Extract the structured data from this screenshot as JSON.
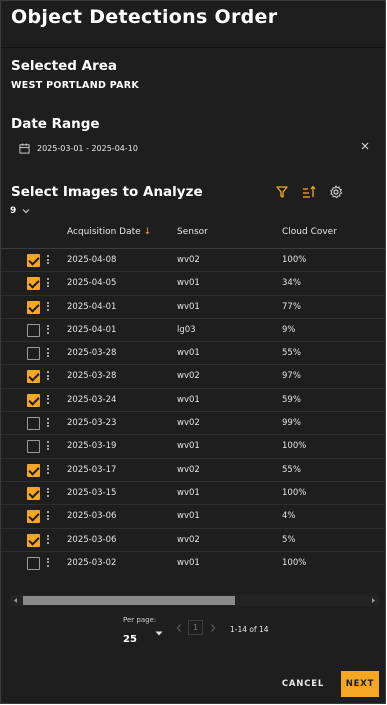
{
  "title": "Object Detections Order",
  "selected_area": {
    "heading": "Selected Area",
    "name": "WEST PORTLAND PARK"
  },
  "date_range": {
    "heading": "Date Range",
    "value": "2025-03-01 - 2025-04-10"
  },
  "images": {
    "heading": "Select Images to Analyze",
    "selected_count": "9",
    "columns": {
      "date": "Acquisition Date",
      "sensor": "Sensor",
      "cloud": "Cloud Cover"
    },
    "sort_indicator": "↓",
    "rows": [
      {
        "checked": true,
        "date": "2025-04-08",
        "sensor": "wv02",
        "cloud": "100%"
      },
      {
        "checked": true,
        "date": "2025-04-05",
        "sensor": "wv01",
        "cloud": "34%"
      },
      {
        "checked": true,
        "date": "2025-04-01",
        "sensor": "wv01",
        "cloud": "77%"
      },
      {
        "checked": false,
        "date": "2025-04-01",
        "sensor": "lg03",
        "cloud": "9%"
      },
      {
        "checked": false,
        "date": "2025-03-28",
        "sensor": "wv01",
        "cloud": "55%"
      },
      {
        "checked": true,
        "date": "2025-03-28",
        "sensor": "wv02",
        "cloud": "97%"
      },
      {
        "checked": true,
        "date": "2025-03-24",
        "sensor": "wv01",
        "cloud": "59%"
      },
      {
        "checked": false,
        "date": "2025-03-23",
        "sensor": "wv02",
        "cloud": "99%"
      },
      {
        "checked": false,
        "date": "2025-03-19",
        "sensor": "wv01",
        "cloud": "100%"
      },
      {
        "checked": true,
        "date": "2025-03-17",
        "sensor": "wv02",
        "cloud": "55%"
      },
      {
        "checked": true,
        "date": "2025-03-15",
        "sensor": "wv01",
        "cloud": "100%"
      },
      {
        "checked": true,
        "date": "2025-03-06",
        "sensor": "wv01",
        "cloud": "4%"
      },
      {
        "checked": true,
        "date": "2025-03-06",
        "sensor": "wv02",
        "cloud": "5%"
      },
      {
        "checked": false,
        "date": "2025-03-02",
        "sensor": "wv01",
        "cloud": "100%"
      }
    ]
  },
  "pagination": {
    "per_page_label": "Per page:",
    "per_page": "25",
    "current_page": "1",
    "range": "1-14 of 14"
  },
  "footer": {
    "cancel_label": "CANCEL",
    "next_label": "NEXT"
  },
  "colors": {
    "background": "#1e1e1e",
    "accent": "#f5a623",
    "text": "#ffffff"
  },
  "icons": [
    "calendar-icon",
    "close-icon",
    "filter-icon",
    "sort-icon",
    "gear-icon",
    "chevron-down-icon",
    "more-vertical-icon",
    "chevron-left-icon",
    "chevron-right-icon",
    "arrow-down-icon"
  ]
}
